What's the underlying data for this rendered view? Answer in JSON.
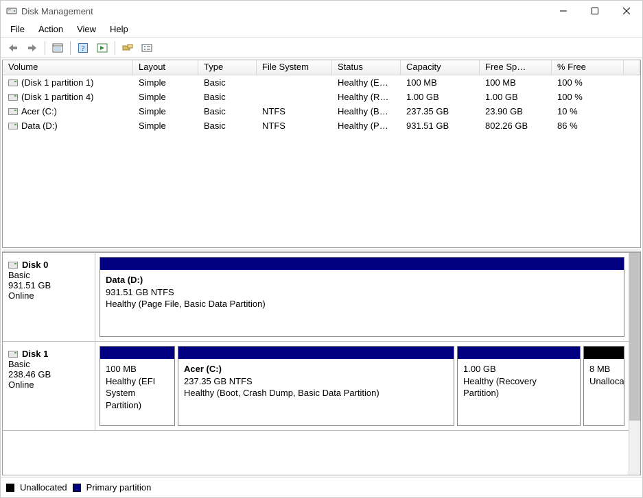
{
  "window": {
    "title": "Disk Management"
  },
  "menu": {
    "file": "File",
    "action": "Action",
    "view": "View",
    "help": "Help"
  },
  "columns": {
    "volume": "Volume",
    "layout": "Layout",
    "type": "Type",
    "filesystem": "File System",
    "status": "Status",
    "capacity": "Capacity",
    "freespace": "Free Sp…",
    "pctfree": "% Free"
  },
  "volumes": [
    {
      "name": "(Disk 1 partition 1)",
      "layout": "Simple",
      "type": "Basic",
      "fs": "",
      "status": "Healthy (E…",
      "capacity": "100 MB",
      "free": "100 MB",
      "pct": "100 %"
    },
    {
      "name": "(Disk 1 partition 4)",
      "layout": "Simple",
      "type": "Basic",
      "fs": "",
      "status": "Healthy (R…",
      "capacity": "1.00 GB",
      "free": "1.00 GB",
      "pct": "100 %"
    },
    {
      "name": "Acer (C:)",
      "layout": "Simple",
      "type": "Basic",
      "fs": "NTFS",
      "status": "Healthy (B…",
      "capacity": "237.35 GB",
      "free": "23.90 GB",
      "pct": "10 %"
    },
    {
      "name": "Data (D:)",
      "layout": "Simple",
      "type": "Basic",
      "fs": "NTFS",
      "status": "Healthy (P…",
      "capacity": "931.51 GB",
      "free": "802.26 GB",
      "pct": "86 %"
    }
  ],
  "disks": [
    {
      "label": "Disk 0",
      "type": "Basic",
      "size": "931.51 GB",
      "state": "Online",
      "partitions": [
        {
          "title": "Data  (D:)",
          "sub": "931.51 GB NTFS",
          "status": "Healthy (Page File, Basic Data Partition)",
          "kind": "primary"
        }
      ]
    },
    {
      "label": "Disk 1",
      "type": "Basic",
      "size": "238.46 GB",
      "state": "Online",
      "partitions": [
        {
          "title": "",
          "sub": "100 MB",
          "status": "Healthy (EFI System Partition)",
          "kind": "primary"
        },
        {
          "title": "Acer  (C:)",
          "sub": "237.35 GB NTFS",
          "status": "Healthy (Boot, Crash Dump, Basic Data Partition)",
          "kind": "primary"
        },
        {
          "title": "",
          "sub": "1.00 GB",
          "status": "Healthy (Recovery Partition)",
          "kind": "primary"
        },
        {
          "title": "",
          "sub": "8 MB",
          "status": "Unallocated",
          "kind": "unalloc"
        }
      ]
    }
  ],
  "legend": {
    "unallocated": "Unallocated",
    "primary": "Primary partition"
  }
}
